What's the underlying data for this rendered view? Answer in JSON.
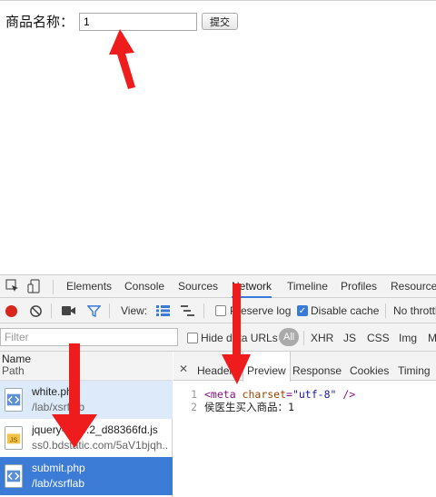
{
  "form": {
    "label": "商品名称：",
    "input_value": "1",
    "submit_label": "提交"
  },
  "devtools": {
    "tabs": [
      "Elements",
      "Console",
      "Sources",
      "Network",
      "Timeline",
      "Profiles",
      "Resources"
    ],
    "active_tab": "Network",
    "toolbar": {
      "view_label": "View:",
      "preserve_log": "Preserve log",
      "disable_cache": "Disable cache",
      "throttle": "No throttling"
    },
    "filter": {
      "placeholder": "Filter",
      "hide_data_urls": "Hide data URLs",
      "all": "All",
      "types": [
        "XHR",
        "JS",
        "CSS",
        "Img",
        "Media"
      ]
    },
    "requests": {
      "header_name": "Name",
      "header_path": "Path",
      "rows": [
        {
          "name": "white.php",
          "path": "/lab/xsrflab",
          "icon": "html-file-icon"
        },
        {
          "name": "jquery-1.10.2_d88366fd.js",
          "path": "ss0.bdstatic.com/5aV1bjqh...",
          "icon": "js-file-icon"
        },
        {
          "name": "submit.php",
          "path": "/lab/xsrflab",
          "icon": "html-file-icon"
        }
      ]
    },
    "detail": {
      "tabs": [
        "Headers",
        "Preview",
        "Response",
        "Cookies",
        "Timing"
      ],
      "active_tab": "Preview",
      "lines": [
        {
          "num": "1",
          "tag_open": "<meta ",
          "attr": "charset",
          "eq": "=",
          "val": "\"utf-8\"",
          "tag_close": " />"
        },
        {
          "num": "2",
          "text": "侯医生买入商品：1"
        }
      ]
    }
  },
  "colors": {
    "accent": "#3879d9",
    "selected_row": "#3c7bd6",
    "record": "#d9261c",
    "annotation_arrow": "#ee1c1c"
  }
}
